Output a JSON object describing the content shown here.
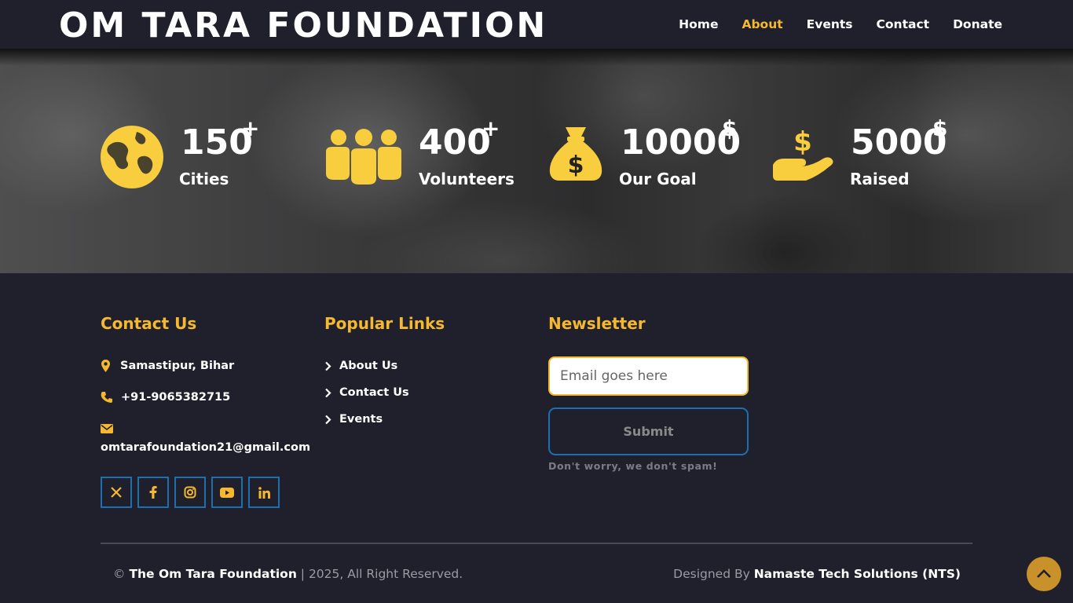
{
  "header": {
    "brand": "OM TARA FOUNDATION",
    "nav": [
      {
        "label": "Home",
        "active": false
      },
      {
        "label": "About",
        "active": true
      },
      {
        "label": "Events",
        "active": false
      },
      {
        "label": "Contact",
        "active": false
      },
      {
        "label": "Donate",
        "active": false
      }
    ]
  },
  "stats": [
    {
      "icon": "globe-icon",
      "value": "150",
      "suffix": "+",
      "label": "Cities"
    },
    {
      "icon": "people-icon",
      "value": "400",
      "suffix": "+",
      "label": "Volunteers"
    },
    {
      "icon": "money-bag-icon",
      "value": "10000",
      "suffix": "$",
      "label": "Our Goal"
    },
    {
      "icon": "hand-dollar-icon",
      "value": "5000",
      "suffix": "$",
      "label": "Raised"
    }
  ],
  "contact": {
    "title": "Contact Us",
    "address": "Samastipur, Bihar",
    "phone": "+91-9065382715",
    "email": "omtarafoundation21@gmail.com",
    "socials": [
      "x-icon",
      "facebook-icon",
      "instagram-icon",
      "youtube-icon",
      "linkedin-icon"
    ]
  },
  "links": {
    "title": "Popular Links",
    "items": [
      "About Us",
      "Contact Us",
      "Events"
    ]
  },
  "newsletter": {
    "title": "Newsletter",
    "placeholder": "Email goes here",
    "submit": "Submit",
    "note": "Don't worry, we don't spam!"
  },
  "bottom": {
    "copy_prefix": "©",
    "copy_org": "The Om Tara Foundation",
    "copy_suffix": "| 2025, All Right Reserved.",
    "designed_prefix": "Designed By",
    "designed_by": "Namaste Tech Solutions (NTS)"
  },
  "colors": {
    "accent": "#f5b82e",
    "background": "#20202c",
    "border_blue": "#1e6fae"
  }
}
